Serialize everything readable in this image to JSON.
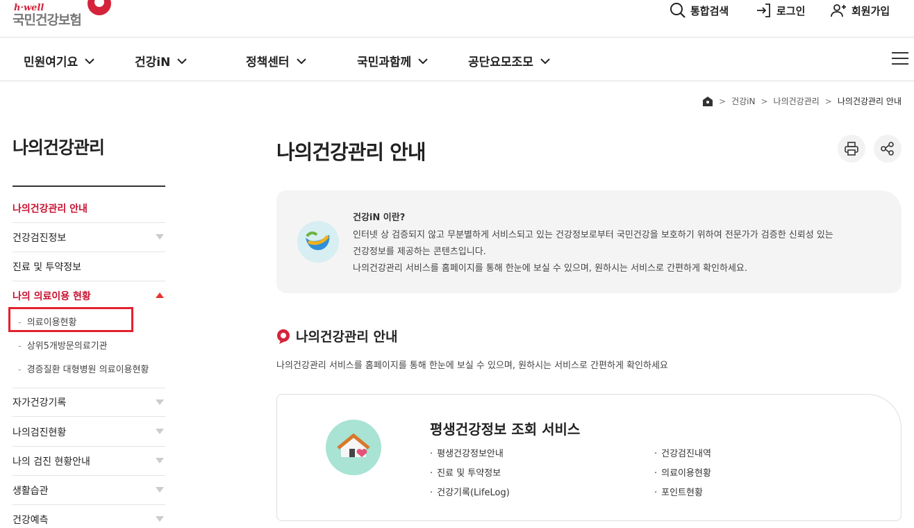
{
  "header": {
    "logo_sub": "h·well",
    "logo_main": "국민건강보험",
    "util": {
      "search_label": "통합검색",
      "login_label": "로그인",
      "join_label": "회원가입"
    }
  },
  "gnb": {
    "items": [
      {
        "label": "민원여기요"
      },
      {
        "label": "건강iN"
      },
      {
        "label": "정책센터"
      },
      {
        "label": "국민과함께"
      },
      {
        "label": "공단요모조모"
      }
    ]
  },
  "breadcrumb": {
    "items": [
      "건강iN",
      "나의건강관리",
      "나의건강관리 안내"
    ]
  },
  "sidebar": {
    "title": "나의건강관리",
    "items": [
      {
        "label": "나의건강관리 안내"
      },
      {
        "label": "건강검진정보"
      },
      {
        "label": "진료 및 투약정보"
      },
      {
        "label": "나의 의료이용 현황"
      },
      {
        "label": "자가건강기록"
      },
      {
        "label": "나의검진현황"
      },
      {
        "label": "나의 검진 현황안내"
      },
      {
        "label": "생활습관"
      },
      {
        "label": "건강예측"
      }
    ],
    "sub_dash": "-",
    "sub_items": [
      {
        "label": "의료이용현황"
      },
      {
        "label": "상위5개방문의료기관"
      },
      {
        "label": "경증질환 대형병원 의료이용현황"
      }
    ]
  },
  "main": {
    "title": "나의건강관리 안내",
    "info": {
      "heading": "건강iN 이란?",
      "line1": "인터넷 상 검증되지 않고 무분별하게 서비스되고 있는 건강정보로부터 국민건강을 보호하기 위하여 전문가가 검증한 신뢰성 있는",
      "line2": "건강정보를 제공하는 콘텐츠입니다.",
      "line3": "나의건강관리 서비스를 홈페이지를 통해 한눈에 보실 수 있으며, 원하시는 서비스로 간편하게 확인하세요."
    },
    "section": {
      "title": "나의건강관리 안내",
      "desc": "나의건강관리 서비스를 홈페이지를 통해 한눈에 보실 수 있으며, 원하시는 서비스로 간편하게 확인하세요"
    },
    "card": {
      "title": "평생건강정보 조회 서비스",
      "bullet": "·",
      "col1": [
        "평생건강정보안내",
        "진료 및 투약정보",
        "건강기록(LifeLog)"
      ],
      "col2": [
        "건강검진내역",
        "의료이용현황",
        "포인트현황"
      ]
    }
  },
  "colors": {
    "brand_red": "#c8102e",
    "highlight_box": "#e3202f",
    "card_icon_bg": "#a8e3d3"
  }
}
